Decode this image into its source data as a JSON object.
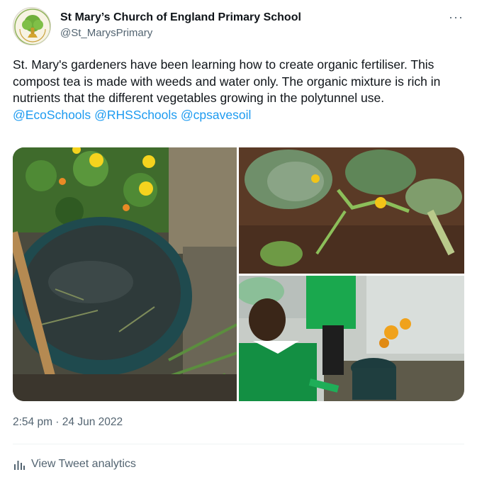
{
  "author": {
    "name": "St Mary’s Church of England Primary School",
    "handle": "@St_MarysPrimary",
    "avatar_icon": "school-logo-tree",
    "more_icon": "more-dots-icon"
  },
  "tweet": {
    "text": "St. Mary's gardeners have been learning how to create organic fertiliser. This compost tea is made with weeds and water only. The organic mixture is rich in nutrients that the different vegetables growing in the polytunnel use.",
    "mentions": [
      "@EcoSchools",
      "@RHSSchools",
      "@cpsavesoil"
    ]
  },
  "footer": {
    "timestamp": "2:54 pm · 24 Jun 2022",
    "analytics_label": "View Tweet analytics"
  },
  "colors": {
    "link": "#1d9bf0",
    "secondary_text": "#536471"
  }
}
